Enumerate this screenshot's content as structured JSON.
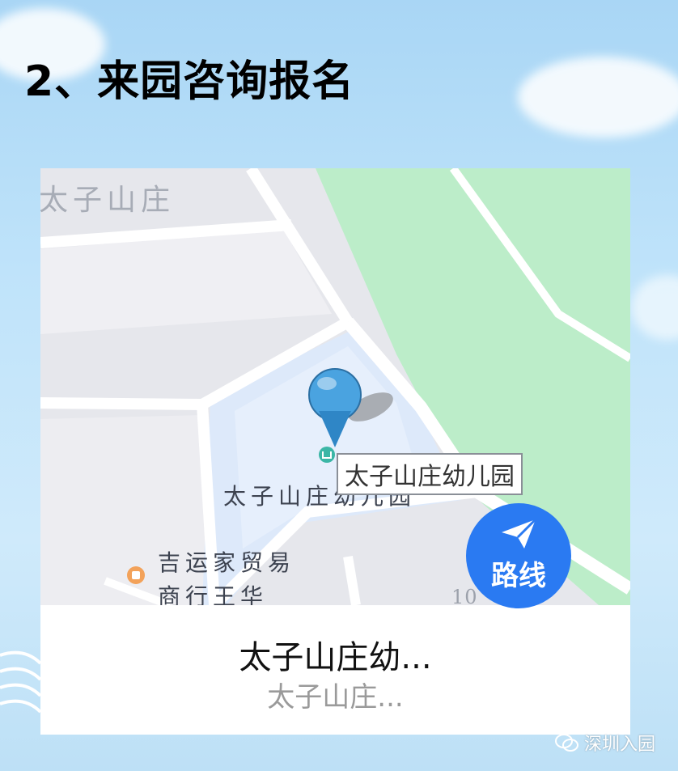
{
  "heading": "2、来园咨询报名",
  "map": {
    "labels": {
      "top_left_area": "太子山庄",
      "kindergarten_map_label": "太子山庄幼儿园",
      "shop_line1": "吉运家贸易",
      "shop_line2": "商行王华",
      "road_number": "10"
    },
    "poi_callout": "太子山庄幼儿园",
    "route_button_label": "路线"
  },
  "place": {
    "name": "太子山庄幼...",
    "address": "太子山庄..."
  },
  "watermark": "深圳入园",
  "colors": {
    "route_button": "#2a7af2",
    "park": "#bcedc9",
    "campus": "#dde9fa",
    "pin": "#4aa3e0"
  }
}
